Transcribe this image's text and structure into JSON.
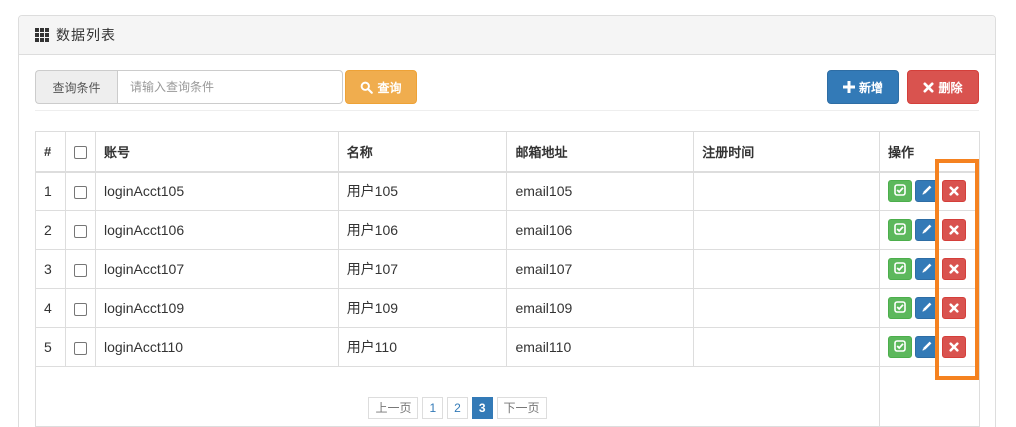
{
  "panel": {
    "title": "数据列表"
  },
  "search": {
    "addon_label": "查询条件",
    "placeholder": "请输入查询条件",
    "button_label": "查询"
  },
  "toolbar": {
    "add_label": "新增",
    "delete_label": "删除"
  },
  "table": {
    "columns": [
      "#",
      "",
      "账号",
      "名称",
      "邮箱地址",
      "注册时间",
      "操作"
    ],
    "rows": [
      {
        "num": "1",
        "account": "loginAcct105",
        "name": "用户105",
        "email": "email105",
        "time": ""
      },
      {
        "num": "2",
        "account": "loginAcct106",
        "name": "用户106",
        "email": "email106",
        "time": ""
      },
      {
        "num": "3",
        "account": "loginAcct107",
        "name": "用户107",
        "email": "email107",
        "time": ""
      },
      {
        "num": "4",
        "account": "loginAcct109",
        "name": "用户109",
        "email": "email109",
        "time": ""
      },
      {
        "num": "5",
        "account": "loginAcct110",
        "name": "用户110",
        "email": "email110",
        "time": ""
      }
    ]
  },
  "pagination": {
    "prev": "上一页",
    "pages": [
      "1",
      "2",
      "3"
    ],
    "active": "3",
    "next": "下一页"
  },
  "colors": {
    "primary": "#337ab7",
    "success": "#5cb85c",
    "danger": "#d9534f",
    "warning": "#f0ad4e",
    "highlight": "#f58220"
  },
  "icons": {
    "header": "th-icon",
    "search": "search-icon",
    "add": "plus-icon",
    "delete": "remove-icon",
    "assign": "check-square-icon",
    "edit": "pencil-icon",
    "remove": "remove-icon"
  }
}
